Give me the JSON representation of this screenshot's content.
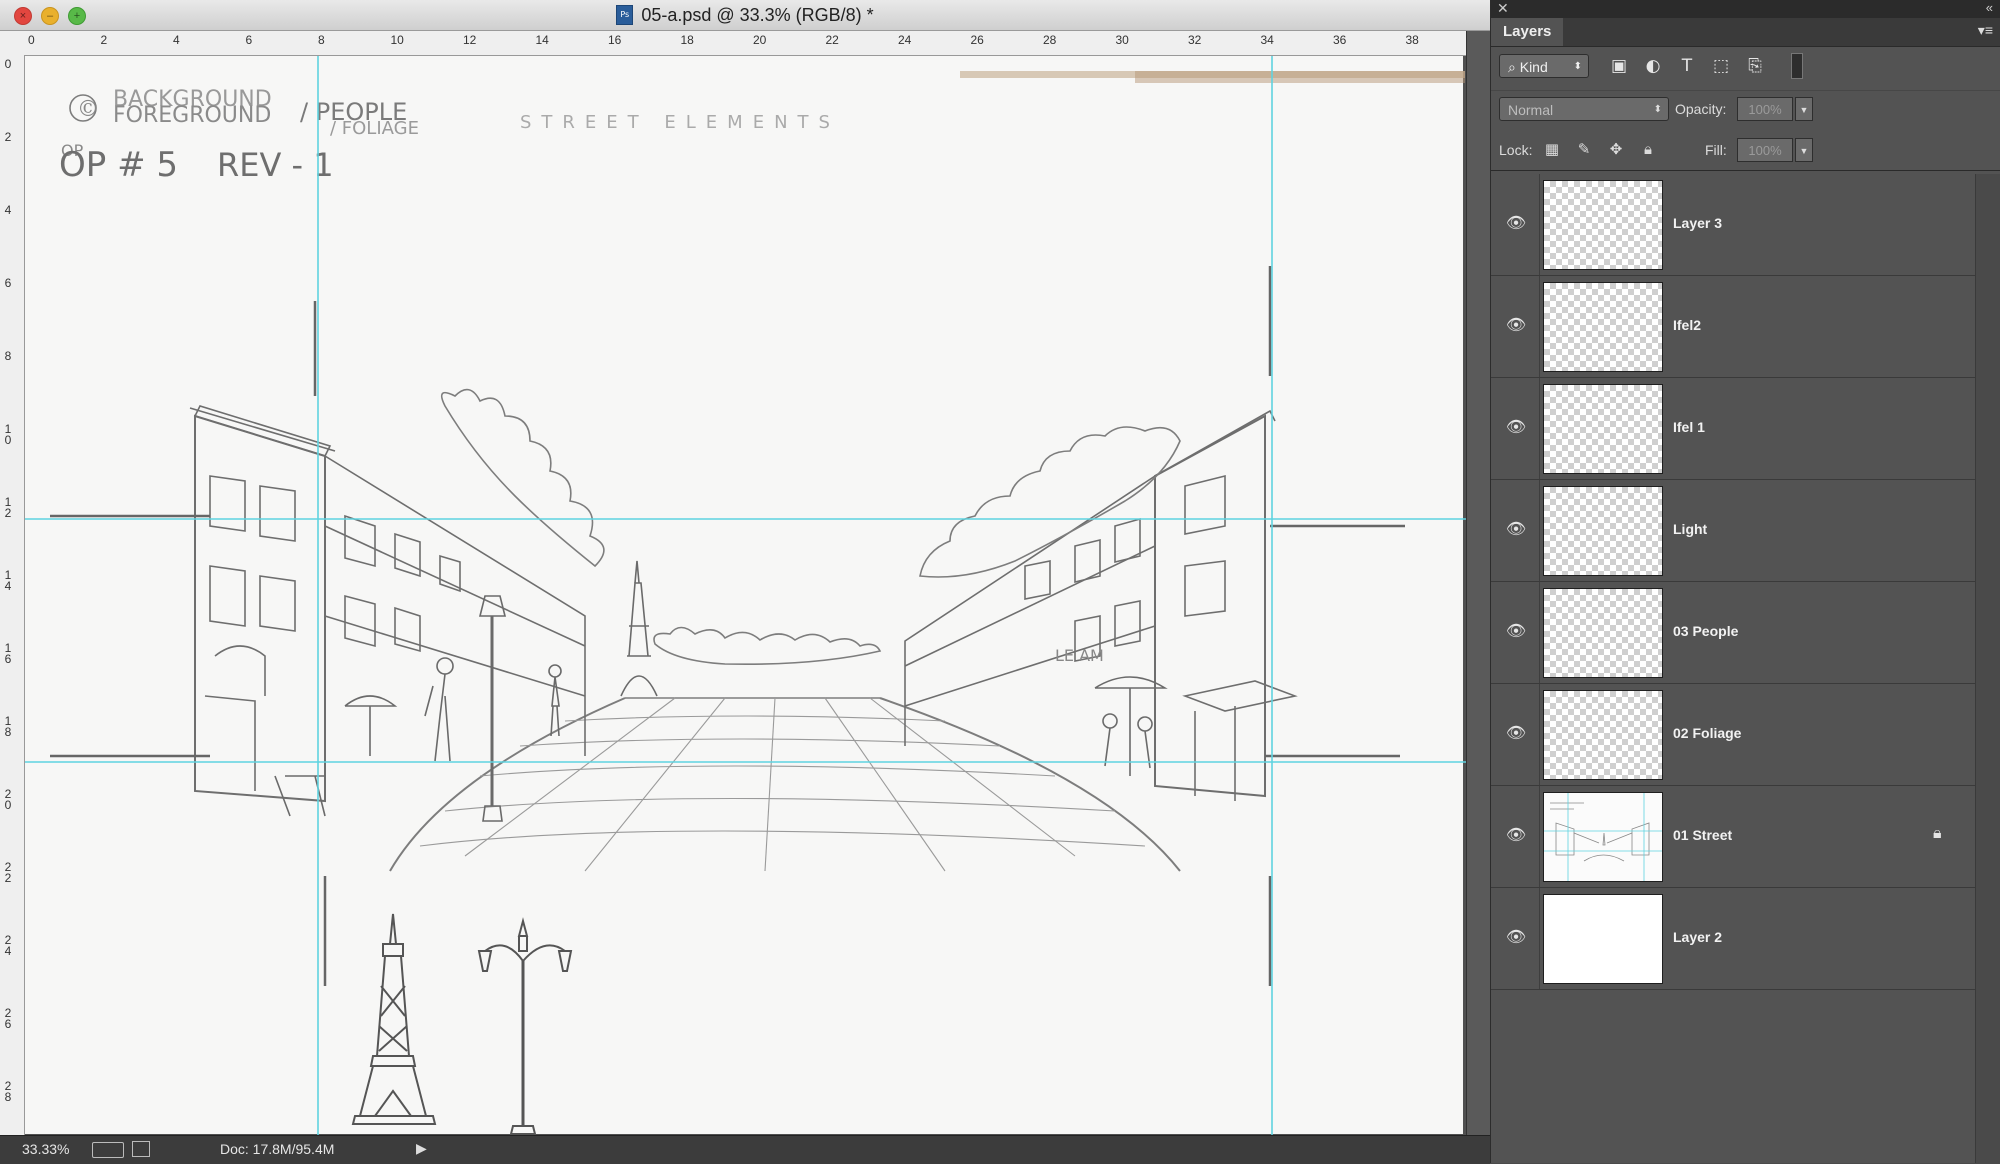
{
  "window": {
    "title": "05-a.psd @ 33.3% (RGB/8) *",
    "file_badge": "Ps"
  },
  "rulers": {
    "horizontal": [
      "0",
      "2",
      "4",
      "6",
      "8",
      "10",
      "12",
      "14",
      "16",
      "18",
      "20",
      "22",
      "24",
      "26",
      "28",
      "30",
      "32",
      "34",
      "36",
      "38"
    ],
    "vertical": [
      "0",
      "2",
      "4",
      "6",
      "8",
      "10",
      "12",
      "14",
      "16",
      "18",
      "20",
      "22",
      "24",
      "26",
      "28"
    ]
  },
  "canvas": {
    "notes": {
      "line1_top": "BACKGROUND",
      "line1_over": "FOREGROUND",
      "line1_rest": "/ PEOPLE",
      "line1_sub": "/ FOLIAGE",
      "line1_tail": "STREET ELEMENTS",
      "line2_a": "OP # 5",
      "line2_b": "REV - 1",
      "line2_small": "OP",
      "copyright": "©"
    },
    "sign": "LE AM",
    "guide_color": "#5fd3e0"
  },
  "status": {
    "zoom": "33.33%",
    "doc": "Doc: 17.8M/95.4M",
    "arrow": "▶"
  },
  "layers_panel": {
    "tab": "Layers",
    "close": "✕",
    "collapse": "«",
    "menu": "▾≡",
    "filter_kind": "Kind",
    "filter_icons": [
      "image-filter-icon",
      "adjustment-filter-icon",
      "type-filter-icon",
      "shape-filter-icon",
      "smart-object-filter-icon"
    ],
    "blend_mode": "Normal",
    "opacity_label": "Opacity:",
    "opacity_value": "100%",
    "lock_label": "Lock:",
    "fill_label": "Fill:",
    "fill_value": "100%",
    "layers": [
      {
        "name": "Layer 3",
        "thumb": "transparent",
        "locked": false
      },
      {
        "name": "Ifel2",
        "thumb": "transparent",
        "locked": false
      },
      {
        "name": "Ifel 1",
        "thumb": "transparent",
        "locked": false
      },
      {
        "name": "Light",
        "thumb": "transparent",
        "locked": false
      },
      {
        "name": "03 People",
        "thumb": "transparent",
        "locked": false
      },
      {
        "name": "02 Foliage",
        "thumb": "transparent",
        "locked": false
      },
      {
        "name": "01 Street",
        "thumb": "sketch",
        "locked": true
      },
      {
        "name": "Layer 2",
        "thumb": "white",
        "locked": false
      }
    ]
  }
}
